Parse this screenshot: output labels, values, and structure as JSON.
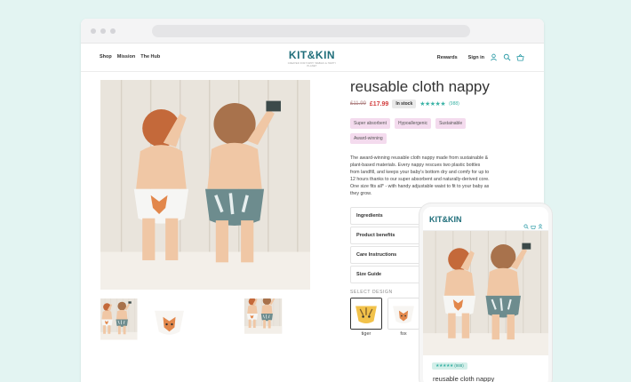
{
  "nav": {
    "shop": "Shop",
    "mission": "Mission",
    "hub": "The Hub",
    "rewards": "Rewards",
    "signin": "Sign in"
  },
  "logo": {
    "main": "KIT&KIN",
    "sub": "CREATED FOR HAPPY BABIES & HAPPY PLANET"
  },
  "product": {
    "title": "reusable cloth nappy",
    "old_price": "£11.99",
    "price": "£17.99",
    "stock": "In stock",
    "stars": "★★★★★",
    "reviews": "(988)",
    "tags": [
      "Super absorbent",
      "Hypoallergenic",
      "Sustainable",
      "Award-winning"
    ],
    "description": "The award-winning reusable cloth nappy made from sustainable & plant-based materials. Every nappy rescues two plastic bottles from landfill, and keeps your baby's bottom dry and comfy for up to 12 hours thanks to our super absorbent and ",
    "description_cont": "naturally-derived core.",
    "description_2": "One size fits all* - with handy adjustable waist to fit to your baby as they grow.",
    "accordion": [
      "Ingredients",
      "Product benefits",
      "Care Instructions",
      "Size Guide"
    ],
    "select_label": "SELECT DESIGN",
    "designs": [
      "tiger",
      "fox"
    ]
  },
  "mobile": {
    "logo": "KIT&KIN",
    "stars": "★★★★★",
    "reviews": "(988)",
    "title": "reusable cloth nappy"
  },
  "colors": {
    "teal": "#2a9aa6",
    "brand": "#1f6e7a",
    "tag": "#f4dbee",
    "price": "#d23e3e",
    "background": "#e3f4f2"
  },
  "icons": [
    "user-icon",
    "search-icon",
    "basket-icon"
  ]
}
